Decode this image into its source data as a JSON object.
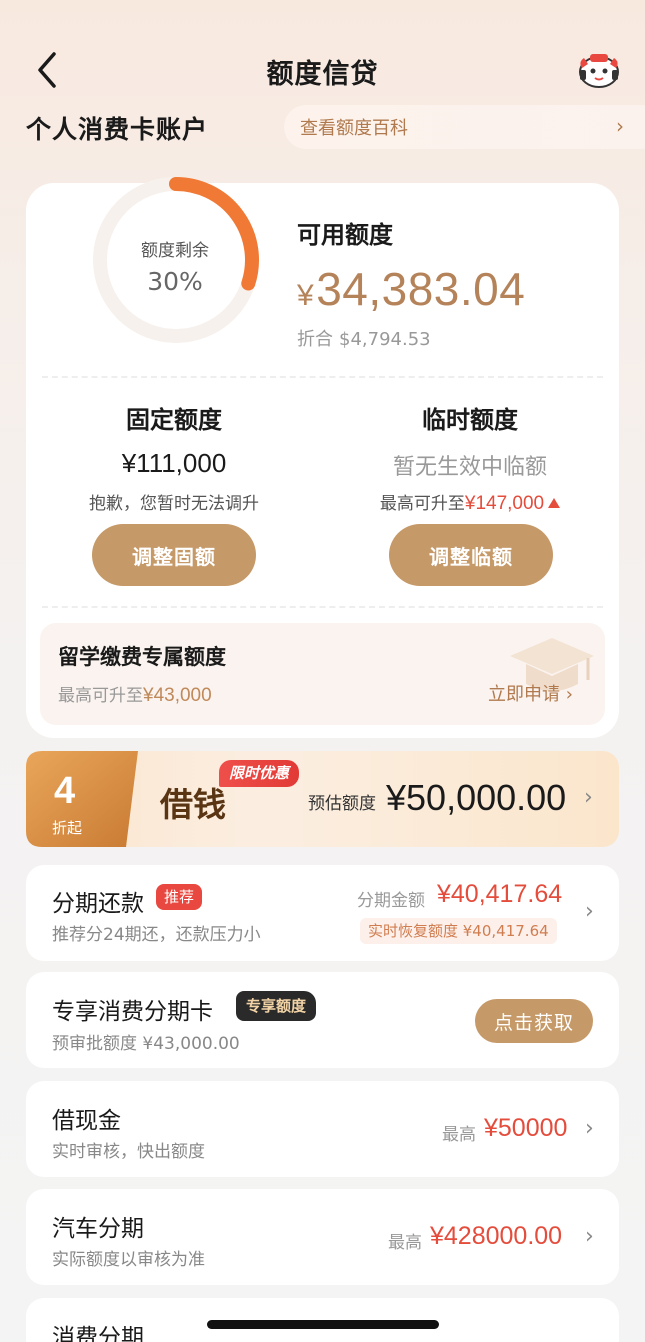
{
  "header": {
    "title": "额度信贷",
    "back_icon": "chevron-left-icon",
    "assistant_icon": "mascot-icon"
  },
  "account": {
    "title": "个人消费卡账户",
    "wiki_link": "查看额度百科"
  },
  "quota": {
    "ring_label": "额度剩余",
    "ring_percent_text": "30%",
    "ring_fraction": 0.3,
    "available_label": "可用额度",
    "currency_symbol": "¥",
    "available_amount": "34,383.04",
    "converted_label": "折合",
    "converted_amount": "$4,794.53",
    "fixed": {
      "title": "固定额度",
      "value": "¥111,000",
      "note": "抱歉，您暂时无法调升",
      "button": "调整固额"
    },
    "temporary": {
      "title": "临时额度",
      "value": "暂无生效中临额",
      "note_prefix": "最高可升至",
      "note_amount": "¥147,000",
      "button": "调整临额"
    },
    "study": {
      "title": "留学缴费专属额度",
      "note_prefix": "最高可升至",
      "note_amount": "¥43,000",
      "apply": "立即申请"
    }
  },
  "borrow": {
    "badge_number": "4",
    "badge_sub": "折起",
    "title": "借钱",
    "promo_tag": "限时优惠",
    "est_label": "预估额度",
    "est_value": "¥50,000.00"
  },
  "items": [
    {
      "title": "分期还款",
      "tag": "推荐",
      "subtitle": "推荐分24期还，还款压力小",
      "amount_label": "分期金额",
      "amount": "¥40,417.64",
      "recover_text": "实时恢复额度 ¥40,417.64"
    },
    {
      "title": "专享消费分期卡",
      "tag": "专享额度",
      "subtitle": "预审批额度 ¥43,000.00",
      "button": "点击获取"
    },
    {
      "title": "借现金",
      "subtitle": "实时审核，快出额度",
      "max_label": "最高",
      "max_value": "¥50000"
    },
    {
      "title": "汽车分期",
      "subtitle": "实际额度以审核为准",
      "max_label": "最高",
      "max_value": "¥428000.00"
    },
    {
      "title": "消费分期"
    }
  ],
  "colors": {
    "accent_gold": "#c59968",
    "ring_orange": "#f07a35",
    "amount_red": "#e44c3c"
  }
}
